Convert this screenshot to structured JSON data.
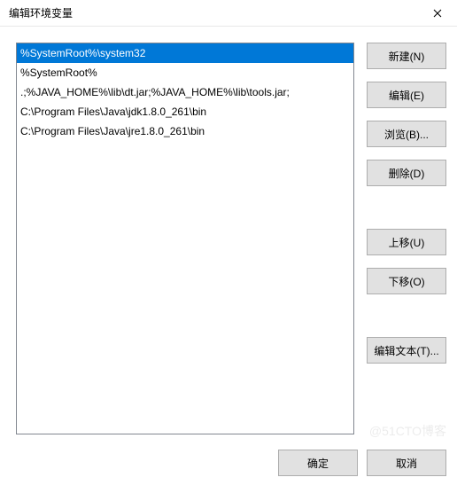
{
  "title": "编辑环境变量",
  "list": {
    "selected_index": 0,
    "items": [
      "%SystemRoot%\\system32",
      "%SystemRoot%",
      ".;%JAVA_HOME%\\lib\\dt.jar;%JAVA_HOME%\\lib\\tools.jar;",
      "C:\\Program Files\\Java\\jdk1.8.0_261\\bin",
      "C:\\Program Files\\Java\\jre1.8.0_261\\bin"
    ]
  },
  "buttons": {
    "new": "新建(N)",
    "edit": "编辑(E)",
    "browse": "浏览(B)...",
    "delete": "删除(D)",
    "move_up": "上移(U)",
    "move_down": "下移(O)",
    "edit_text": "编辑文本(T)...",
    "ok": "确定",
    "cancel": "取消"
  },
  "watermark": "@51CTO博客"
}
